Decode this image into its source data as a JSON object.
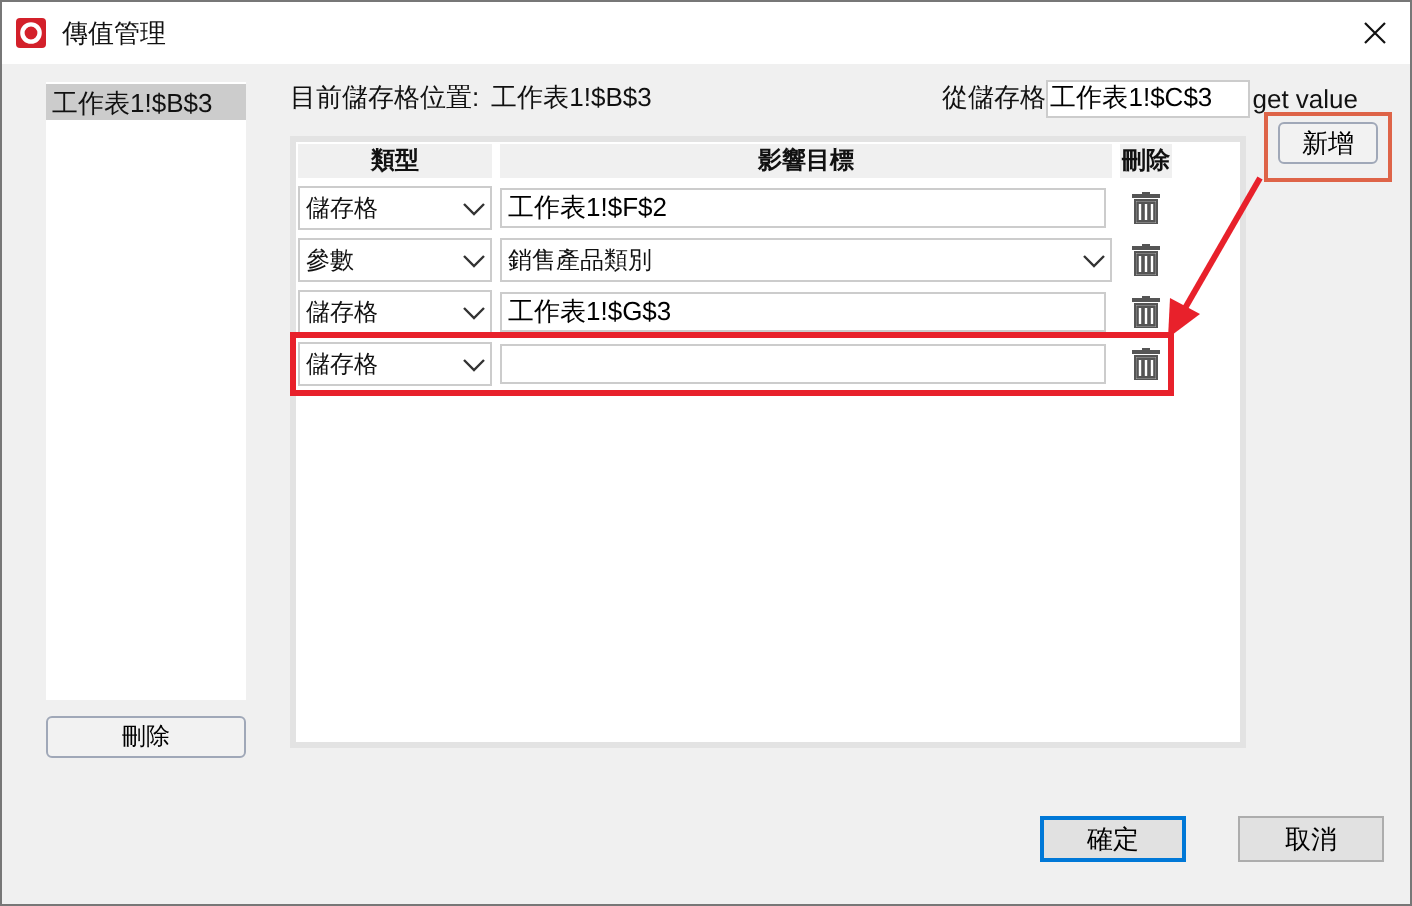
{
  "window": {
    "title": "傳值管理"
  },
  "sheet_list": {
    "items": [
      {
        "label": "工作表1!$B$3",
        "selected": true
      }
    ],
    "delete_button": "刪除"
  },
  "current_cell": {
    "label": "目前儲存格位置:",
    "value": "工作表1!$B$3"
  },
  "source": {
    "label": "從儲存格",
    "value": "工作表1!$C$3",
    "suffix": "get value"
  },
  "table": {
    "columns": [
      "類型",
      "影響目標",
      "刪除"
    ],
    "rows": [
      {
        "type": "儲存格",
        "kind": "field",
        "target": "工作表1!$F$2",
        "highlighted": false
      },
      {
        "type": "參數",
        "kind": "dropdown",
        "target": "銷售產品類別",
        "highlighted": false
      },
      {
        "type": "儲存格",
        "kind": "field",
        "target": "工作表1!$G$3",
        "highlighted": false
      },
      {
        "type": "儲存格",
        "kind": "field",
        "target": "",
        "highlighted": true
      }
    ]
  },
  "add_button": {
    "label": "新增",
    "highlighted": true
  },
  "annotations": [
    {
      "kind": "arrow"
    }
  ],
  "buttons": [
    {
      "label": "確定",
      "default": true
    },
    {
      "label": "取消",
      "default": false
    }
  ]
}
